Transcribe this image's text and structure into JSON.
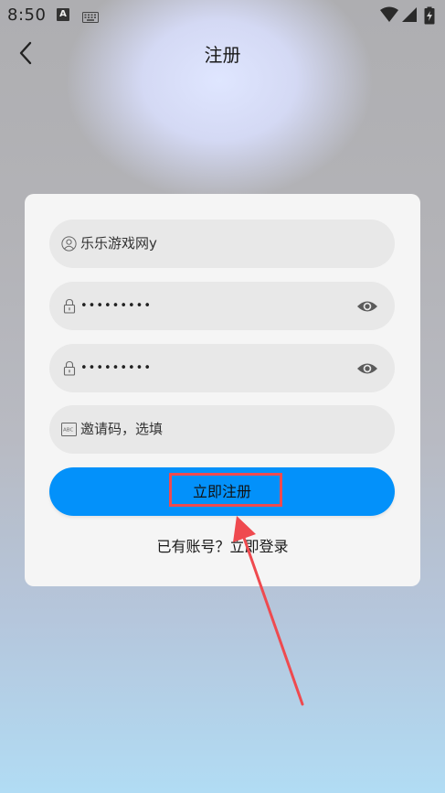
{
  "status_bar": {
    "time": "8:50",
    "notification_a": "A",
    "icons": [
      "keyboard-icon",
      "wifi-icon",
      "signal-icon",
      "battery-icon"
    ]
  },
  "header": {
    "title": "注册"
  },
  "form": {
    "username_value": "乐乐游戏网y",
    "password_value": "•••••••••",
    "confirm_password_value": "•••••••••",
    "invite_placeholder": "邀请码，选填",
    "submit_label": "立即注册"
  },
  "footer": {
    "have_account_text": "已有账号？",
    "login_link": "立即登录"
  },
  "colors": {
    "primary": "#0391fa",
    "annotation": "#ef4a4f",
    "field_bg": "#e8e8e8",
    "card_bg": "#f5f5f5"
  }
}
